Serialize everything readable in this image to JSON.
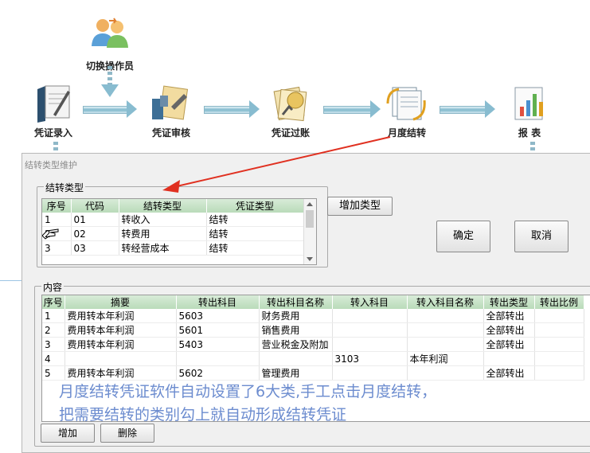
{
  "workflow": {
    "switch_operator": "切换操作员",
    "nodes": [
      "凭证录入",
      "凭证审核",
      "凭证过账",
      "月度结转",
      "报 表"
    ]
  },
  "dialog": {
    "title": "结转类型维护",
    "types_group": {
      "label": "结转类型",
      "columns": [
        "序号",
        "代码",
        "结转类型",
        "凭证类型"
      ],
      "rows": [
        [
          "1",
          "01",
          "转收入",
          "结转"
        ],
        [
          "2",
          "02",
          "转费用",
          "结转"
        ],
        [
          "3",
          "03",
          "转经营成本",
          "结转"
        ]
      ],
      "add_type_button": "增加类型"
    },
    "ok_button": "确定",
    "cancel_button": "取消",
    "content_group": {
      "label": "内容",
      "columns": [
        "序号",
        "摘要",
        "转出科目",
        "转出科目名称",
        "转入科目",
        "转入科目名称",
        "转出类型",
        "转出比例"
      ],
      "rows": [
        [
          "1",
          "费用转本年利润",
          "5603",
          "财务费用",
          "",
          "",
          "全部转出",
          ""
        ],
        [
          "2",
          "费用转本年利润",
          "5601",
          "销售费用",
          "",
          "",
          "全部转出",
          ""
        ],
        [
          "3",
          "费用转本年利润",
          "5403",
          "营业税金及附加",
          "",
          "",
          "全部转出",
          ""
        ],
        [
          "4",
          "",
          "",
          "",
          "3103",
          "本年利润",
          "",
          ""
        ],
        [
          "5",
          "费用转本年利润",
          "5602",
          "管理费用",
          "",
          "",
          "全部转出",
          ""
        ]
      ],
      "add_button": "增加",
      "delete_button": "删除"
    }
  },
  "annotation": {
    "line1": "月度结转凭证软件自动设置了6大类,手工点击月度结转，",
    "line2": "把需要结转的类别勾上就自动形成结转凭证",
    "color": "#6c8ccf",
    "arrow_color": "#e03020"
  }
}
